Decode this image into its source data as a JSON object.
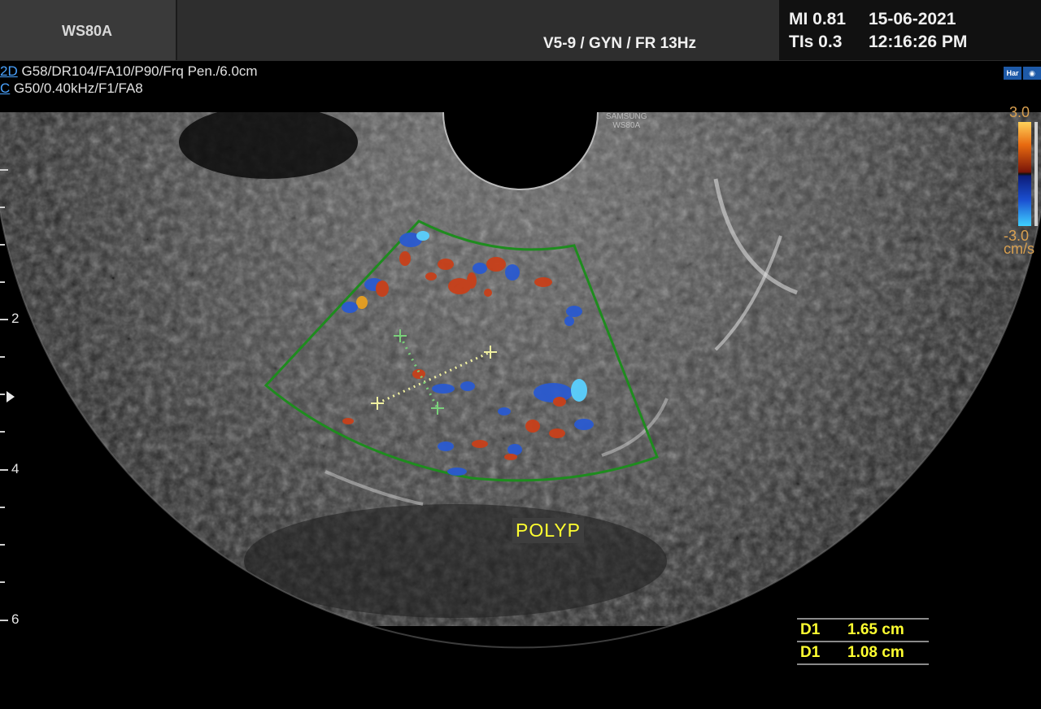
{
  "header": {
    "model": "WS80A",
    "probe_preset": "V5-9 / GYN / FR 13Hz",
    "mi": "MI  0.81",
    "tis": "TIs 0.3",
    "date": "15-06-2021",
    "time": "12:16:26 PM"
  },
  "params": {
    "mode_2d": "2D",
    "line_2d": "G58/DR104/FA10/P90/Frq Pen./6.0cm",
    "mode_c": "C",
    "line_c": "G50/0.40kHz/F1/FA8"
  },
  "icons": [
    "Har",
    "probe-icon"
  ],
  "color_scale": {
    "top": "3.0",
    "bottom": "-3.0",
    "unit": "cm/s"
  },
  "depth_scale": {
    "labels": [
      "2",
      "4",
      "6"
    ]
  },
  "image_brand": {
    "line1": "SAMSUNG",
    "line2": "WS80A"
  },
  "annotation": "POLYP",
  "measurements": [
    {
      "label": "D1",
      "value": "1.65 cm"
    },
    {
      "label": "D1",
      "value": "1.08 cm"
    }
  ],
  "colors": {
    "roi_box": "#1e8c1e",
    "measurement_text": "#ffff30",
    "doppler_red": "#c8401a",
    "doppler_blue": "#2a5ad0"
  }
}
